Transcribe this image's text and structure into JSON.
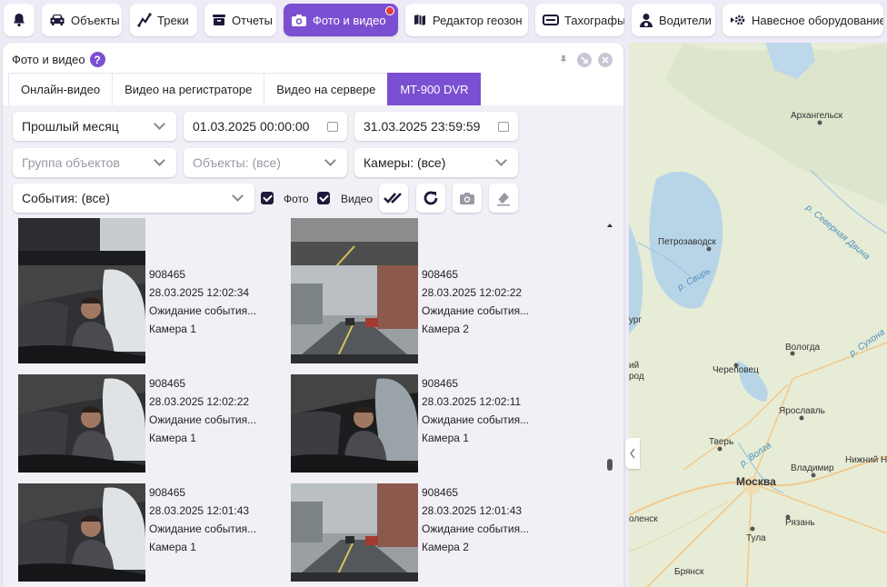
{
  "toolbar": {
    "items": [
      {
        "label": "",
        "icon": "bell-icon"
      },
      {
        "label": "Объекты",
        "icon": "car-icon"
      },
      {
        "label": "Треки",
        "icon": "track-icon"
      },
      {
        "label": "Отчеты",
        "icon": "reports-icon"
      },
      {
        "label": "Фото и видео",
        "icon": "camera-icon"
      },
      {
        "label": "Редактор геозон",
        "icon": "geozone-icon"
      },
      {
        "label": "Тахографы",
        "icon": "tachograph-icon"
      },
      {
        "label": "Водители",
        "icon": "driver-icon"
      },
      {
        "label": "Навесное оборудование",
        "icon": "equipment-icon"
      }
    ]
  },
  "panel": {
    "title": "Фото и видео",
    "help": "?",
    "tabs": [
      "Онлайн-видео",
      "Видео на регистраторе",
      "Видео на сервере",
      "MT-900 DVR"
    ]
  },
  "filters": {
    "period": "Прошлый месяц",
    "date_from": "01.03.2025 00:00:00",
    "date_to": "31.03.2025 23:59:59",
    "group_placeholder": "Группа объектов",
    "objects_placeholder": "Объекты: (все)",
    "cameras": "Камеры: (все)",
    "events": "События: (все)",
    "photo_label": "Фото",
    "video_label": "Видео"
  },
  "items": [
    {
      "id": "908465",
      "time": "28.03.2025 12:02:34",
      "status": "Ожидание события...",
      "camera": "Камера 1"
    },
    {
      "id": "908465",
      "time": "28.03.2025 12:02:22",
      "status": "Ожидание события...",
      "camera": "Камера 2"
    },
    {
      "id": "908465",
      "time": "28.03.2025 12:02:22",
      "status": "Ожидание события...",
      "camera": "Камера 1"
    },
    {
      "id": "908465",
      "time": "28.03.2025 12:02:11",
      "status": "Ожидание события...",
      "camera": "Камера 1"
    },
    {
      "id": "908465",
      "time": "28.03.2025 12:01:43",
      "status": "Ожидание события...",
      "camera": "Камера 1"
    },
    {
      "id": "908465",
      "time": "28.03.2025 12:01:43",
      "status": "Ожидание события...",
      "camera": "Камера 2"
    }
  ],
  "map": {
    "labels": [
      "Архангельск",
      "Петрозаводск",
      "р. Свирь",
      "Вологда",
      "Череповец",
      "Ярославль",
      "Тверь",
      "р. Волга",
      "Владимир",
      "Москва",
      "Нижний Н",
      "Рязань",
      "Тула",
      "Брянск",
      "оленск",
      "р. Северная Двина",
      "р. Сухона",
      "ург",
      "ий",
      "род"
    ]
  }
}
